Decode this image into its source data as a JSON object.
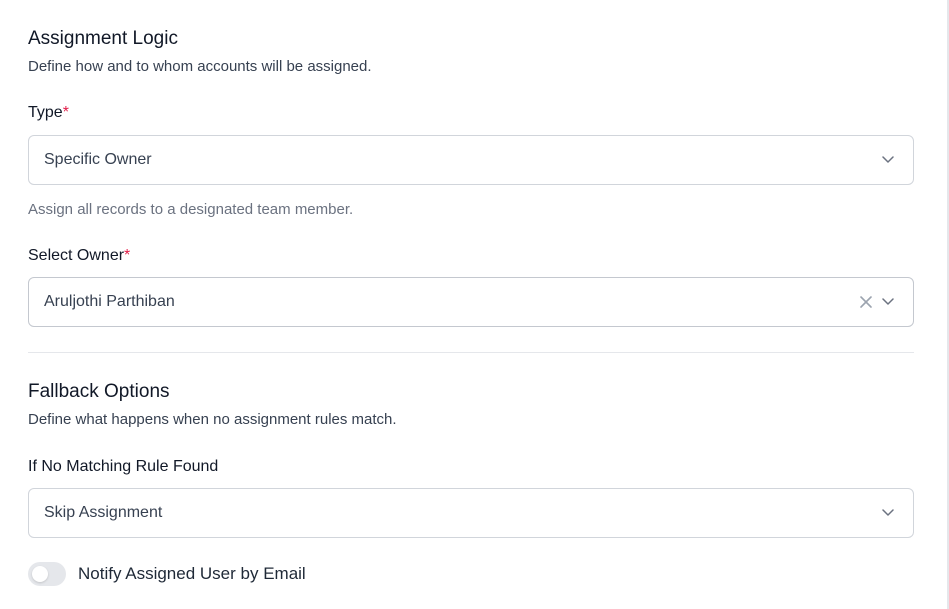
{
  "assignment": {
    "title": "Assignment Logic",
    "description": "Define how and to whom accounts will be assigned.",
    "type_field": {
      "label": "Type",
      "required_mark": "*",
      "value": "Specific Owner",
      "helper": "Assign all records to a designated team member."
    },
    "owner_field": {
      "label": "Select Owner",
      "required_mark": "*",
      "value": "Aruljothi Parthiban"
    }
  },
  "fallback": {
    "title": "Fallback Options",
    "description": "Define what happens when no assignment rules match.",
    "no_match_field": {
      "label": "If No Matching Rule Found",
      "value": "Skip Assignment"
    }
  },
  "notify": {
    "label": "Notify Assigned User by Email",
    "enabled": false
  },
  "icons": {
    "dropdown": "chevron-down-icon",
    "clear": "close-icon"
  },
  "colors": {
    "required": "#e11d48",
    "toggle_off": "#e5e7eb",
    "border": "#d1d5db",
    "text_primary": "#111827",
    "text_muted": "#6b7280"
  }
}
